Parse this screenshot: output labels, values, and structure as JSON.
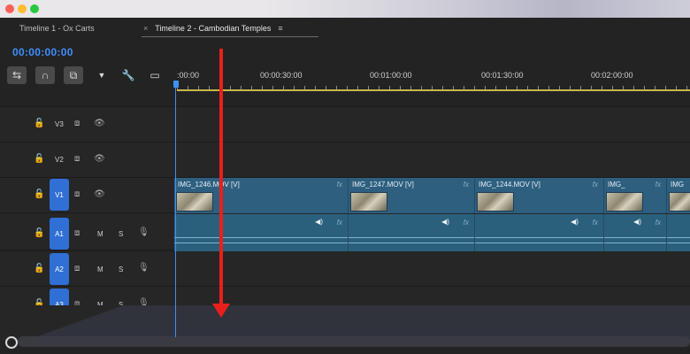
{
  "window": {
    "controls": [
      "close",
      "minimize",
      "zoom"
    ]
  },
  "tabs": [
    {
      "label": "Timeline 1 - Ox Carts"
    },
    {
      "label": "Timeline 2 - Cambodian Temples",
      "close_glyph": "×",
      "menu_glyph": "≡"
    }
  ],
  "timecode": "00:00:00:00",
  "tools": [
    {
      "icon": "insert-sequence-icon",
      "glyph": "⇆"
    },
    {
      "icon": "snap-magnet-icon",
      "glyph": "∩"
    },
    {
      "icon": "linked-selection-icon",
      "glyph": "⧉"
    },
    {
      "icon": "add-marker-icon",
      "glyph": "▼"
    },
    {
      "icon": "wrench-icon",
      "glyph": "🔧"
    },
    {
      "icon": "captions-icon",
      "glyph": "▭"
    }
  ],
  "ruler": {
    "labels": [
      ":00:00",
      "00:00:30:00",
      "00:01:00:00",
      "00:01:30:00",
      "00:02:00:00"
    ]
  },
  "tracks": [
    {
      "label": "V3",
      "kind": "video",
      "source_patch": false
    },
    {
      "label": "V2",
      "kind": "video",
      "source_patch": false
    },
    {
      "label": "V1",
      "kind": "video",
      "source_patch": true
    },
    {
      "label": "A1",
      "kind": "audio",
      "source_patch": true,
      "m": "M",
      "s": "S"
    },
    {
      "label": "A2",
      "kind": "audio",
      "source_patch": true,
      "m": "M",
      "s": "S"
    },
    {
      "label": "A3",
      "kind": "audio",
      "source_patch": true,
      "m": "M",
      "s": "S"
    }
  ],
  "video_clips": [
    {
      "name": "IMG_1246.MOV [V]",
      "fx": "fx"
    },
    {
      "name": "IMG_1247.MOV [V]",
      "fx": "fx"
    },
    {
      "name": "IMG_1244.MOV [V]",
      "fx": "fx"
    },
    {
      "name": "IMG_",
      "fx": "fx"
    },
    {
      "name": "IMG",
      "fx": ""
    }
  ],
  "audio_fx": "fx",
  "colors": {
    "accent": "#3f8ffb",
    "clip": "#2e5f7f",
    "annotation_arrow": "#e8201b",
    "work_area": "#c8b84a"
  }
}
